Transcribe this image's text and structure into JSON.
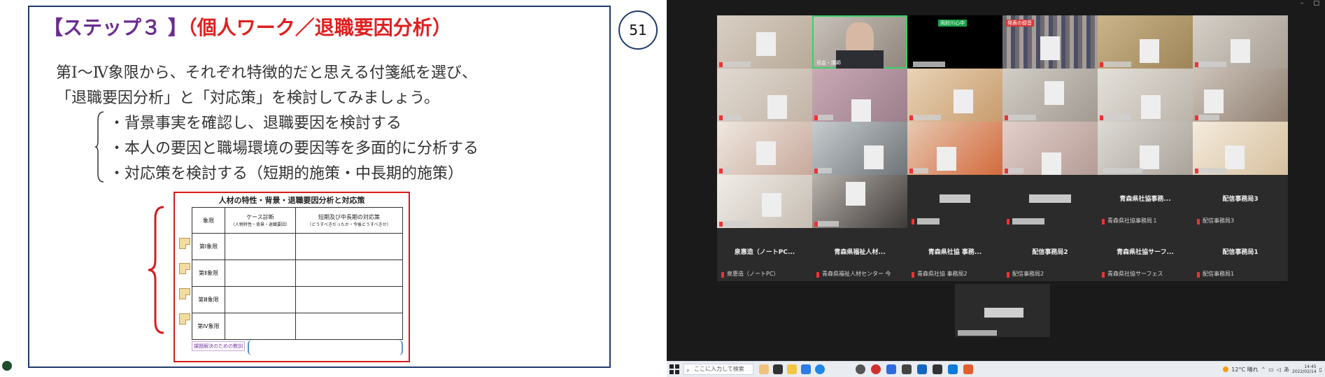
{
  "slide": {
    "title_part1": "【ステップ３ 】",
    "title_part2": "（個人ワーク／退職要因分析）",
    "page_number": "51",
    "intro_lines": [
      "第Ⅰ～Ⅳ象限から、それぞれ特徴的だと思える付箋紙を選び、",
      "「退職要因分析」と「対応策」を検討してみましょう。"
    ],
    "bullets": [
      "・背景事実を確認し、退職要因を検討する",
      "・本人の要因と職場環境の要因等を多面的に分析する",
      "・対応策を検討する（短期的施策・中長期的施策）"
    ],
    "worksheet": {
      "title": "人材の特性・背景・退職要因分析と対応策",
      "col_quadrant": "象限",
      "col_case": "ケース診断",
      "col_case_sub": "（人物特性・背景・退職要因）",
      "col_measure": "短期及び中長期の対応策",
      "col_measure_sub": "（どうすべきだったか・今後どうすべきか）",
      "rows": [
        "第Ⅰ象限",
        "第Ⅱ象限",
        "第Ⅲ象限",
        "第Ⅳ象限"
      ],
      "footer_label": "課題解決のための教訓"
    }
  },
  "zoom": {
    "window_controls": [
      "–",
      "□"
    ],
    "top_strip": {
      "green_pill": "両肘川心中",
      "red_pill": "発表の録音"
    },
    "presenter_name": "司会・講師",
    "named_tiles_row4": [
      {
        "label": "青森県社協事務...",
        "sub": "青森県社協事務局１"
      },
      {
        "label": "配信事務局3",
        "sub": "配信事務局3"
      }
    ],
    "named_tiles_row5": [
      {
        "label": "泉惠造（ノートPC...",
        "sub": "泉惠造（ノートPC）"
      },
      {
        "label": "青森県福祉人材...",
        "sub": "青森県福祉人材センター 今"
      },
      {
        "label": "青森県社協 事務...",
        "sub": "青森県社協 事務局2"
      },
      {
        "label": "配信事務局2",
        "sub": "配信事務局2"
      },
      {
        "label": "青森県社協サーフ...",
        "sub": "青森県社協サーフェス"
      },
      {
        "label": "配信事務局1",
        "sub": "配信事務局1"
      }
    ]
  },
  "taskbar": {
    "search_placeholder": "ここに入力して検索",
    "weather": "12°C 晴れ",
    "ime": "あ",
    "time": "14:45",
    "date": "2022/02/14"
  }
}
